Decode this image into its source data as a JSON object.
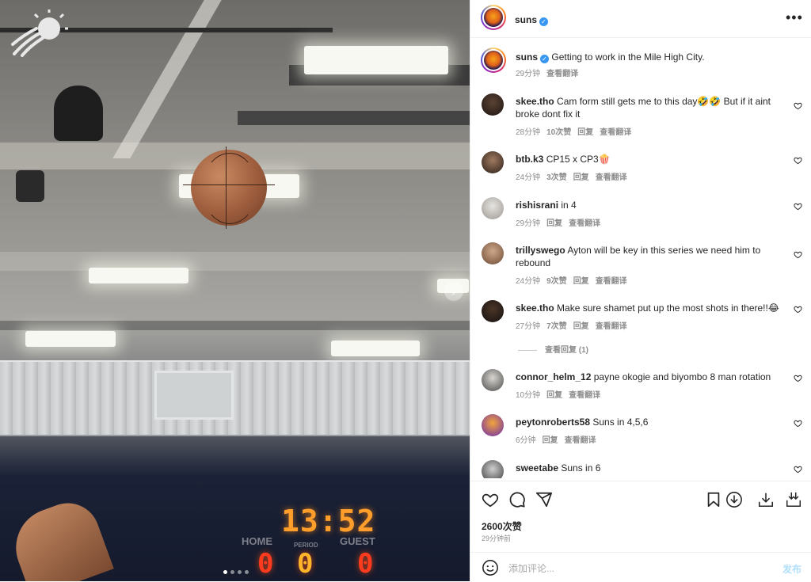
{
  "media": {
    "scoreboard": {
      "clock": "13:52",
      "home_label": "HOME",
      "period_label": "PERIOD",
      "guest_label": "GUEST",
      "home_score": "0",
      "period": "0",
      "guest_score": "0"
    },
    "carousel_next_glyph": "›",
    "carousel": {
      "count": 4,
      "active_index": 0
    }
  },
  "post": {
    "author": "suns",
    "verified": true,
    "more_glyph": "•••",
    "caption": "Getting to work in the Mile High City.",
    "caption_time": "29分钟",
    "caption_translate": "查看翻译"
  },
  "comments": [
    {
      "user": "skee.tho",
      "text": "Cam form still gets me to this day🤣🤣 But if it aint broke dont fix it",
      "time": "28分钟",
      "likes": "10次赞",
      "reply": "回复",
      "translate": "查看翻译"
    },
    {
      "user": "btb.k3",
      "text": "CP15 x CP3🍿",
      "time": "24分钟",
      "likes": "3次赞",
      "reply": "回复",
      "translate": "查看翻译"
    },
    {
      "user": "rishisrani",
      "text": "in 4",
      "time": "29分钟",
      "likes": "",
      "reply": "回复",
      "translate": "查看翻译"
    },
    {
      "user": "trillyswego",
      "text": "Ayton will be key in this series we need him to rebound",
      "time": "24分钟",
      "likes": "9次赞",
      "reply": "回复",
      "translate": "查看翻译"
    },
    {
      "user": "skee.tho",
      "text": "Make sure shamet put up the most shots in there!!😂",
      "time": "27分钟",
      "likes": "7次赞",
      "reply": "回复",
      "translate": "查看翻译",
      "view_replies": "查看回复 (1)"
    },
    {
      "user": "connor_helm_12",
      "text": "payne okogie and biyombo 8 man rotation",
      "time": "10分钟",
      "likes": "",
      "reply": "回复",
      "translate": "查看翻译"
    },
    {
      "user": "peytonroberts58",
      "text": "Suns in 4,5,6",
      "time": "6分钟",
      "likes": "",
      "reply": "回复",
      "translate": "查看翻译"
    },
    {
      "user": "sweetabe",
      "text": "Suns in 6",
      "time": "",
      "likes": "",
      "reply": "",
      "translate": ""
    }
  ],
  "actions": {
    "like_icon": "heart-icon",
    "comment_icon": "comment-icon",
    "share_icon": "share-icon",
    "save_icon": "bookmark-icon",
    "download_icon": "download-icon"
  },
  "stats": {
    "likes": "2600次赞",
    "posted": "29分钟前"
  },
  "comment_box": {
    "placeholder": "添加评论...",
    "post_label": "发布"
  },
  "colors": {
    "accent_blue": "#3897f0",
    "post_disabled": "#b2dffc",
    "meta_gray": "#8e8e8e",
    "clock_orange": "#ff9e2a",
    "score_red": "#ff3b1f"
  }
}
